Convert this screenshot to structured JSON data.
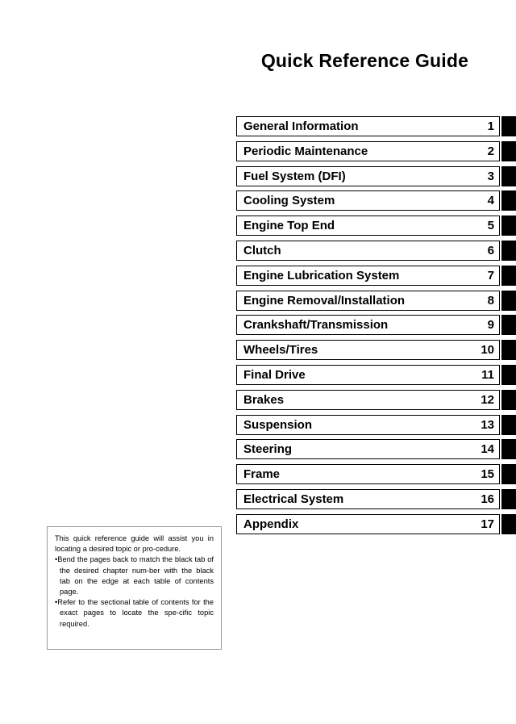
{
  "page": {
    "title": "Quick Reference Guide",
    "background_color": "#ffffff",
    "text_color": "#000000",
    "tab_color": "#000000"
  },
  "chapter_index": {
    "rows": [
      {
        "label": "General Information",
        "number": "1"
      },
      {
        "label": "Periodic Maintenance",
        "number": "2"
      },
      {
        "label": "Fuel System (DFI)",
        "number": "3"
      },
      {
        "label": "Cooling System",
        "number": "4"
      },
      {
        "label": "Engine Top End",
        "number": "5"
      },
      {
        "label": "Clutch",
        "number": "6"
      },
      {
        "label": "Engine Lubrication System",
        "number": "7"
      },
      {
        "label": "Engine Removal/Installation",
        "number": "8"
      },
      {
        "label": "Crankshaft/Transmission",
        "number": "9"
      },
      {
        "label": "Wheels/Tires",
        "number": "10"
      },
      {
        "label": "Final Drive",
        "number": "11"
      },
      {
        "label": "Brakes",
        "number": "12"
      },
      {
        "label": "Suspension",
        "number": "13"
      },
      {
        "label": "Steering",
        "number": "14"
      },
      {
        "label": "Frame",
        "number": "15"
      },
      {
        "label": "Electrical System",
        "number": "16"
      },
      {
        "label": "Appendix",
        "number": "17"
      }
    ]
  },
  "instruction_note": {
    "intro": "This quick reference guide will assist you in locating a desired topic or pro-cedure.",
    "bullets": [
      "•Bend the pages back to match the black tab of the desired chapter num-ber with the black tab on the edge at each table of contents page.",
      "•Refer to the sectional table of contents for the exact pages to locate the spe-cific topic required."
    ]
  }
}
